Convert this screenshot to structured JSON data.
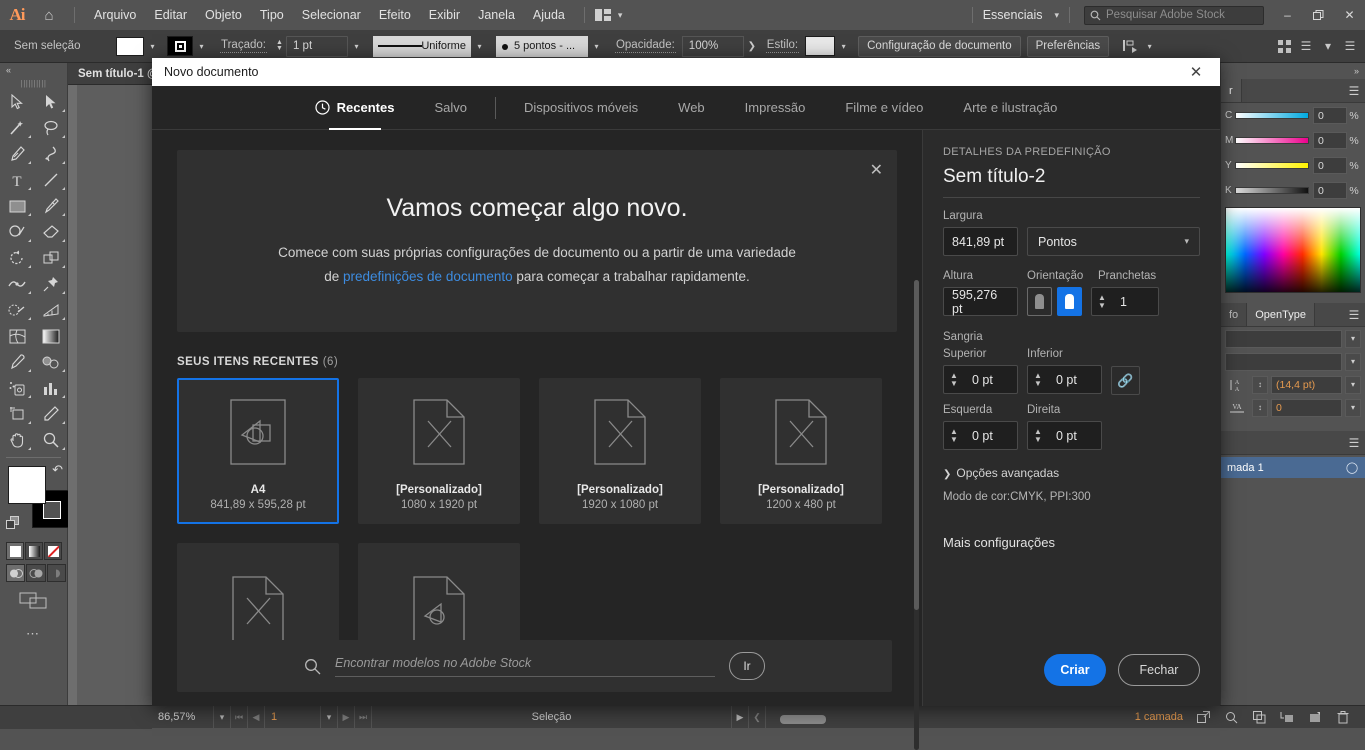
{
  "app": {
    "logo": "Ai",
    "home_icon": "home-icon",
    "menus": [
      "Arquivo",
      "Editar",
      "Objeto",
      "Tipo",
      "Selecionar",
      "Efeito",
      "Exibir",
      "Janela",
      "Ajuda"
    ],
    "layout_switcher_icon": "layout-icon",
    "workspace": "Essenciais",
    "stock_search_placeholder": "Pesquisar Adobe Stock",
    "window_buttons": {
      "minimize": "–",
      "maximize": "❐",
      "close": "✕"
    }
  },
  "control_bar": {
    "selection_status": "Sem seleção",
    "fill_swatch_color": "#ffffff",
    "stroke_label": "Traçado:",
    "stroke_width": "1 pt",
    "brush_profile": "Uniforme",
    "brush_preset": "5 pontos - ...",
    "opacity_label": "Opacidade:",
    "opacity_value": "100%",
    "style_label": "Estilo:",
    "doc_setup_button": "Configuração de documento",
    "preferences_button": "Preferências",
    "align_icon": "align-icon"
  },
  "toolbar": {
    "collapse_icon": "collapse-left-icon",
    "tools": [
      "selection-tool",
      "direct-selection-tool",
      "magic-wand-tool",
      "lasso-tool",
      "pen-tool",
      "curvature-tool",
      "type-tool",
      "line-segment-tool",
      "rectangle-tool",
      "paintbrush-tool",
      "shaper-tool",
      "eraser-tool",
      "rotate-tool",
      "scale-tool",
      "width-tool",
      "free-transform-tool",
      "shape-builder-tool",
      "perspective-grid-tool",
      "mesh-tool",
      "gradient-tool",
      "eyedropper-tool",
      "blend-tool",
      "symbol-sprayer-tool",
      "column-graph-tool",
      "artboard-tool",
      "slice-tool",
      "hand-tool",
      "zoom-tool"
    ],
    "fill_color": "#ffffff",
    "stroke_color": "#000000",
    "swap_icon": "swap-fill-stroke-icon",
    "default_icon": "default-fill-stroke-icon",
    "paint_modes": [
      "color-mode",
      "gradient-mode",
      "none-mode"
    ],
    "draw_modes": [
      "draw-normal",
      "draw-behind",
      "draw-inside"
    ],
    "screen_mode_icon": "screen-mode-icon",
    "more_icon": "edit-toolbar-icon"
  },
  "document_tab": {
    "title": "Sem título-1 @"
  },
  "right_dock": {
    "collapse_icon": "expand-panels-icon",
    "color_panel": {
      "menu_icon": "panel-menu-icon",
      "channels": [
        {
          "name": "C",
          "value": "0",
          "unit": "%",
          "gradient": "cyan"
        },
        {
          "name": "M",
          "value": "0",
          "unit": "%",
          "gradient": "magenta"
        },
        {
          "name": "Y",
          "value": "0",
          "unit": "%",
          "gradient": "yellow"
        },
        {
          "name": "K",
          "value": "0",
          "unit": "%",
          "gradient": "black"
        }
      ]
    },
    "character_panel": {
      "tabs": [
        "fo",
        "OpenType"
      ],
      "active_tab": "OpenType",
      "menu_icon": "panel-menu-icon",
      "leading_icon": "leading-icon",
      "leading_value": "(14,4 pt)",
      "tracking_icon": "tracking-icon",
      "tracking_value": "0"
    },
    "layers_panel": {
      "menu_icon": "panel-menu-icon",
      "layer_name": "mada 1",
      "target_icon": "target-circle-icon"
    }
  },
  "status_bar": {
    "zoom": "86,57%",
    "page": "1",
    "tool_status": "Seleção",
    "layer_count": "1 camada",
    "nav_first": "first-page-icon",
    "nav_prev": "prev-page-icon",
    "nav_next": "next-page-icon",
    "nav_last": "last-page-icon",
    "icons": [
      "new-layer-link-icon",
      "search-icon",
      "duplicate-layer-icon",
      "sublayer-icon",
      "new-layer-icon",
      "delete-layer-icon"
    ]
  },
  "dialog": {
    "title": "Novo documento",
    "close_icon": "close-icon",
    "tabs": [
      {
        "label": "Recentes",
        "icon": "clock-icon",
        "active": true
      },
      {
        "label": "Salvo",
        "active": false
      },
      {
        "label": "Dispositivos móveis",
        "active": false
      },
      {
        "label": "Web",
        "active": false
      },
      {
        "label": "Impressão",
        "active": false
      },
      {
        "label": "Filme e vídeo",
        "active": false
      },
      {
        "label": "Arte e ilustração",
        "active": false
      }
    ],
    "hero": {
      "close_icon": "close-icon",
      "heading": "Vamos começar algo novo.",
      "body_part1": "Comece com suas próprias configurações de documento ou a partir de uma variedade de ",
      "link": "predefinições de documento",
      "body_part2": " para começar a trabalhar rapidamente."
    },
    "recents": {
      "heading": "SEUS ITENS RECENTES",
      "count": "(6)",
      "cards": [
        {
          "name": "A4",
          "dims": "841,89 x 595,28 pt",
          "icon": "artwork-page-icon",
          "selected": true
        },
        {
          "name": "[Personalizado]",
          "dims": "1080 x 1920 pt",
          "icon": "blank-page-icon",
          "selected": false
        },
        {
          "name": "[Personalizado]",
          "dims": "1920 x 1080 pt",
          "icon": "blank-page-icon",
          "selected": false
        },
        {
          "name": "[Personalizado]",
          "dims": "1200 x 480 pt",
          "icon": "blank-page-icon",
          "selected": false
        },
        {
          "name": "",
          "dims": "",
          "icon": "blank-page-icon",
          "selected": false
        },
        {
          "name": "",
          "dims": "",
          "icon": "artwork-page-icon",
          "selected": false
        }
      ]
    },
    "stock": {
      "search_icon": "search-icon",
      "placeholder": "Encontrar modelos no Adobe Stock",
      "go_button": "Ir"
    },
    "details": {
      "header": "DETALHES DA PREDEFINIÇÃO",
      "preset_name": "Sem título-2",
      "width_label": "Largura",
      "width_value": "841,89 pt",
      "units_value": "Pontos",
      "height_label": "Altura",
      "height_value": "595,276 pt",
      "orientation_label": "Orientação",
      "orientation_portrait_icon": "orientation-portrait-icon",
      "orientation_landscape_icon": "orientation-landscape-icon",
      "artboards_label": "Pranchetas",
      "artboards_value": "1",
      "bleed_label": "Sangria",
      "bleed_top_label": "Superior",
      "bleed_top_value": "0 pt",
      "bleed_bottom_label": "Inferior",
      "bleed_bottom_value": "0 pt",
      "bleed_left_label": "Esquerda",
      "bleed_left_value": "0 pt",
      "bleed_right_label": "Direita",
      "bleed_right_value": "0 pt",
      "link_icon": "link-bleed-icon",
      "advanced_label": "Opções avançadas",
      "color_mode_info": "Modo de cor:CMYK, PPI:300",
      "more_settings": "Mais configurações",
      "create_button": "Criar",
      "close_button": "Fechar"
    }
  },
  "colors": {
    "accent": "#1473e6",
    "link": "#3d8ce0",
    "chrome": "#535353",
    "dialog_bg": "#252525"
  }
}
